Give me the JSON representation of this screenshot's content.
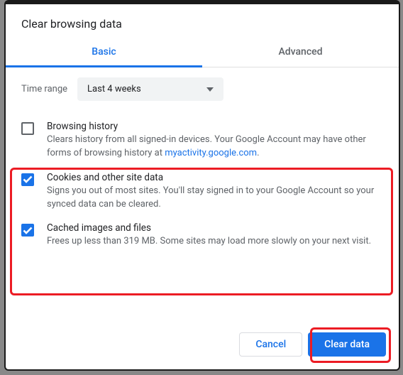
{
  "dialog": {
    "title": "Clear browsing data",
    "tabs": {
      "basic": "Basic",
      "advanced": "Advanced"
    },
    "timerange": {
      "label": "Time range",
      "value": "Last 4 weeks"
    },
    "options": {
      "history": {
        "title": "Browsing history",
        "desc_pre": "Clears history from all signed-in devices. Your Google Account may have other forms of browsing history at ",
        "link": "myactivity.google.com",
        "desc_post": ".",
        "checked": false
      },
      "cookies": {
        "title": "Cookies and other site data",
        "desc": "Signs you out of most sites. You'll stay signed in to your Google Account so your synced data can be cleared.",
        "checked": true
      },
      "cache": {
        "title": "Cached images and files",
        "desc": "Frees up less than 319 MB. Some sites may load more slowly on your next visit.",
        "checked": true
      }
    },
    "buttons": {
      "cancel": "Cancel",
      "clear": "Clear data"
    }
  }
}
